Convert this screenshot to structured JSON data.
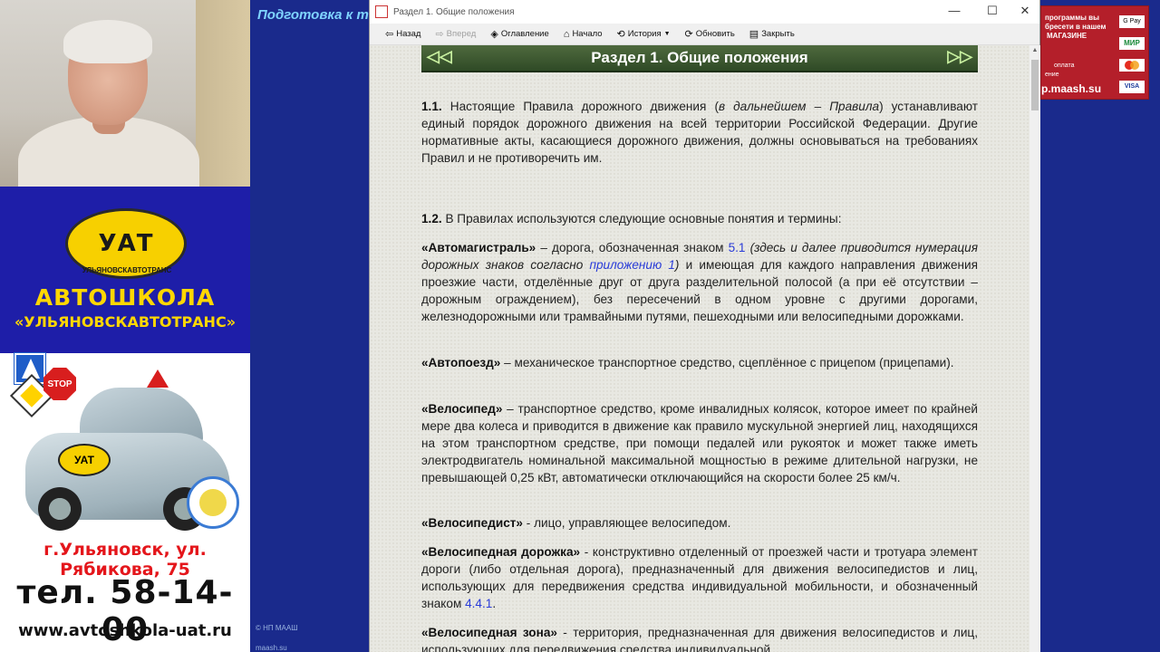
{
  "background_app": {
    "title": "Подготовка к т",
    "footer_copyright": "© НП МААШ",
    "footer_site": "maash.su"
  },
  "promo": {
    "logo_text": "УАТ",
    "logo_sub": "УЛЬЯНОВСКАВТОТРАНС",
    "title": "АВТОШКОЛА",
    "subtitle": "«УЛЬЯНОВСКАВТОТРАНС»",
    "stop_sign": "STOP",
    "hood_logo": "УАТ",
    "address": "г.Ульяновск, ул. Рябикова, 75",
    "phone": "тел. 58-14-00",
    "site": "www.avtoshkola-uat.ru"
  },
  "right_ad": {
    "line1": "программы вы",
    "line2": "бресети в нашем",
    "line3": "МАГАЗИНЕ",
    "line4": "оплата",
    "line5": "ение",
    "site": "p.maash.su",
    "pay": [
      "G Pay",
      "МИР",
      "",
      "VISA"
    ]
  },
  "window": {
    "title": "Раздел 1. Общие положения",
    "controls": {
      "minimize": "—",
      "maximize": "☐",
      "close": "✕"
    },
    "toolbar": {
      "back": "Назад",
      "forward": "Вперед",
      "contents": "Оглавление",
      "home": "Начало",
      "history": "История",
      "refresh": "Обновить",
      "close": "Закрыть"
    }
  },
  "document": {
    "section_title": "Раздел 1. Общие положения",
    "nav_prev": "◁◁",
    "nav_next": "▷▷",
    "p1_1": {
      "num": "1.1.",
      "text_a": " Настоящие Правила дорожного движения (",
      "italic": "в дальнейшем – Правила",
      "text_b": ") устанавливают единый порядок дорожного движения на всей территории Российской Федерации. Другие нормативные акты, касающиеся дорожного движения, должны основываться на требованиях Правил и не противоречить им."
    },
    "p1_2": {
      "num": "1.2.",
      "text": " В Правилах используются следующие основные понятия и термины:"
    },
    "terms": {
      "avtomagistral": {
        "term": "«Автомагистраль»",
        "a": " – дорога, обозначенная знаком ",
        "link1": "5.1",
        "italic_a": " (здесь и далее приводится нумерация дорожных знаков согласно ",
        "link2": "приложению 1",
        "italic_b": ")",
        "b": " и имеющая для каждого направления движения проезжие части, отделённые друг от друга разделительной полосой (а при её отсутствии – дорожным ограждением), без пересечений в одном уровне с другими дорогами, железнодорожными или трамвайными путями, пешеходными или велосипедными дорожками."
      },
      "avtopoezd": {
        "term": "«Автопоезд»",
        "a": " – механическое транспортное средство, сцеплённое с прицепом (прицепами)."
      },
      "velosiped": {
        "term": "«Велосипед»",
        "a": " – транспортное средство, кроме инвалидных колясок, которое имеет по крайней мере два колеса и приводится в движение как правило мускульной энергией лиц, находящихся на этом транспортном средстве, при помощи педалей или рукояток и может также иметь электродвигатель номинальной максимальной мощностью в режиме длительной нагрузки, не превышающей 0,25 кВт, автоматически отключающийся на скорости более 25 км/ч."
      },
      "velosipedist": {
        "term": "«Велосипедист»",
        "a": " - лицо, управляющее велосипедом."
      },
      "velodorozhka": {
        "term": "«Велосипедная дорожка»",
        "a": " - конструктивно отделенный от проезжей части и тротуара элемент дороги (либо отдельная дорога), предназначенный для движения велосипедистов и лиц, использующих для передвижения средства индивидуальной мобильности, и обозначенный знаком ",
        "link": "4.4.1",
        "b": "."
      },
      "velozona": {
        "term": "«Велосипедная зона»",
        "a": " - территория, предназначенная для движения велосипедистов и лиц, использующих для передвижения средства индивидуальной"
      }
    }
  }
}
